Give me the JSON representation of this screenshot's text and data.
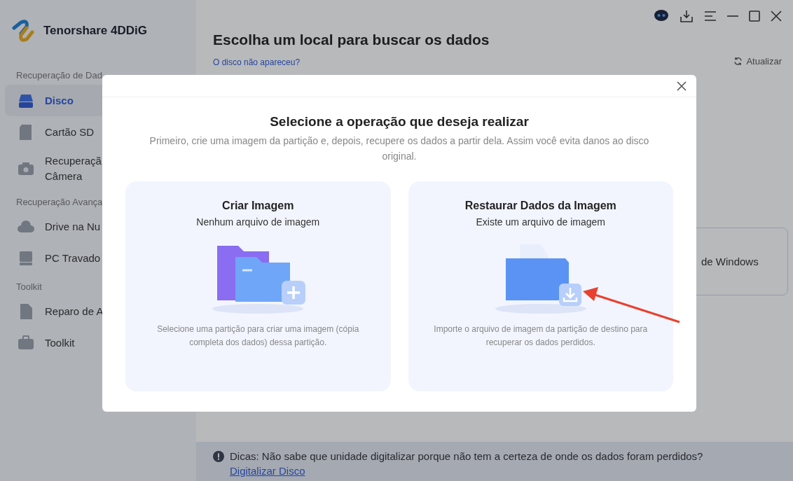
{
  "app": {
    "name": "Tenorshare 4DDiG"
  },
  "sidebar": {
    "sections": [
      {
        "heading": "Recuperação de Dad",
        "items": [
          {
            "label": "Disco",
            "kind": "disk",
            "selected": true
          },
          {
            "label": "Cartão SD",
            "kind": "sd",
            "selected": false
          },
          {
            "label": "Recuperaçã\nCâmera",
            "kind": "camera",
            "selected": false
          }
        ]
      },
      {
        "heading": "Recuperação Avança",
        "items": [
          {
            "label": "Drive na Nu",
            "kind": "cloud",
            "selected": false
          },
          {
            "label": "PC Travado",
            "kind": "pc",
            "selected": false
          }
        ]
      },
      {
        "heading": "Toolkit",
        "items": [
          {
            "label": "Reparo de A",
            "kind": "file",
            "selected": false
          },
          {
            "label": "Toolkit",
            "kind": "toolbox",
            "selected": false
          }
        ]
      }
    ]
  },
  "main": {
    "title": "Escolha um local para buscar os dados",
    "help_link": "O disco não apareceu?",
    "refresh": "Atualizar",
    "card_text": "de Windows"
  },
  "tips": {
    "text": "Dicas: Não sabe que unidade digitalizar porque não tem a certeza de onde os dados foram perdidos?",
    "link": "Digitalizar Disco"
  },
  "modal": {
    "title": "Selecione a operação que deseja realizar",
    "subtitle": "Primeiro, crie uma imagem da partição e, depois, recupere os dados a partir dela. Assim você evita danos ao disco original.",
    "options": [
      {
        "kind": "create",
        "title": "Criar Imagem",
        "subtitle": "Nenhum arquivo de imagem",
        "description": "Selecione uma partição para criar uma imagem (cópia completa dos dados) dessa partição."
      },
      {
        "kind": "restore",
        "title": "Restaurar Dados da Imagem",
        "subtitle": "Existe um arquivo de imagem",
        "description": "Importe o arquivo de imagem da partição de destino para recuperar os dados perdidos."
      }
    ]
  }
}
